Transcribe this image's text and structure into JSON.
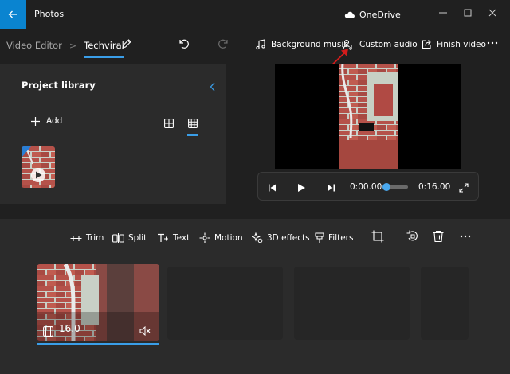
{
  "window": {
    "app_title": "Photos",
    "cloud_label": "OneDrive"
  },
  "toolbar": {
    "breadcrumb_root": "Video Editor",
    "breadcrumb_sep": ">",
    "project_name": "Techviral",
    "background_music": "Background music",
    "custom_audio": "Custom audio",
    "finish_video": "Finish video"
  },
  "library": {
    "title": "Project library",
    "add_label": "Add"
  },
  "player": {
    "current_time": "0:00.00",
    "total_time": "0:16.00",
    "progress": 0
  },
  "storyboard": {
    "tools": {
      "trim": "Trim",
      "split": "Split",
      "text": "Text",
      "motion": "Motion",
      "effects3d": "3D effects",
      "filters": "Filters"
    },
    "clips": [
      {
        "duration": "16.0",
        "muted": true
      }
    ]
  },
  "colors": {
    "accent": "#3a9ee8",
    "back_button": "#0a84d0",
    "annotation_arrow": "#d41c1c"
  }
}
